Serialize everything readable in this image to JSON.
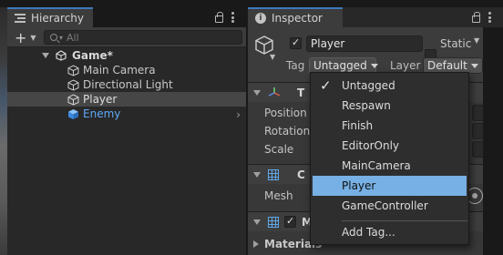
{
  "hierarchy": {
    "tab_label": "Hierarchy",
    "add_symbol": "+",
    "search_placeholder": "All",
    "scene_name": "Game*",
    "items": [
      {
        "label": "Main Camera",
        "icon": "gameobject-cube-icon"
      },
      {
        "label": "Directional Light",
        "icon": "gameobject-cube-icon"
      },
      {
        "label": "Player",
        "icon": "gameobject-cube-icon",
        "selected": true
      },
      {
        "label": "Enemy",
        "icon": "prefab-cube-icon",
        "prefab_color": "#4d9df0"
      }
    ]
  },
  "inspector": {
    "tab_label": "Inspector",
    "object_name": "Player",
    "static_label": "Static",
    "tag_label": "Tag",
    "tag_value": "Untagged",
    "layer_label": "Layer",
    "layer_value": "Default",
    "components": [
      {
        "title": "T",
        "icon": "transform-icon"
      },
      {
        "title": "C",
        "icon": "mesh-filter-grid-icon"
      },
      {
        "title": "M",
        "icon": "mesh-renderer-grid-icon"
      }
    ],
    "transform_props": [
      "Position",
      "Rotation",
      "Scale"
    ],
    "mesh_label": "Mesh",
    "materials_label": "Materials"
  },
  "tag_menu": {
    "items": [
      {
        "label": "Untagged",
        "checked": true
      },
      {
        "label": "Respawn"
      },
      {
        "label": "Finish"
      },
      {
        "label": "EditorOnly"
      },
      {
        "label": "MainCamera"
      },
      {
        "label": "Player",
        "highlighted": true
      },
      {
        "label": "GameController"
      }
    ],
    "add_tag_label": "Add Tag..."
  },
  "colors": {
    "accent_tab": "#3a79bb",
    "menu_highlight": "#77b0e4",
    "prefab_blue": "#4d9df0"
  }
}
